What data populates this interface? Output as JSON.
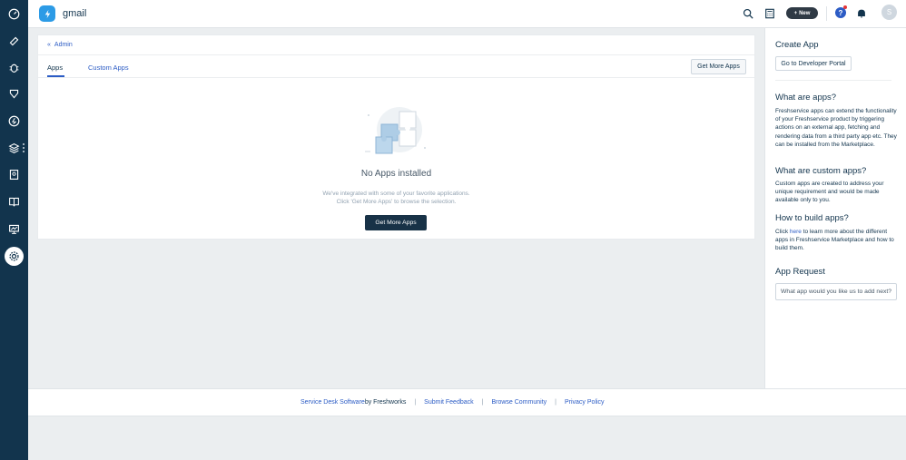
{
  "header": {
    "workspace_name": "gmail",
    "new_label": "New",
    "help_label": "?",
    "avatar_initial": "S"
  },
  "breadcrumb": {
    "label": "Admin"
  },
  "tabs": [
    {
      "label": "Apps",
      "active": true
    },
    {
      "label": "Custom Apps",
      "active": false
    }
  ],
  "toolbar": {
    "get_more_apps_label": "Get More Apps"
  },
  "empty_state": {
    "title": "No Apps installed",
    "description_line1": "We've integrated with some of your favorite applications.",
    "description_line2": "Click 'Get More Apps' to browse the selection.",
    "button_label": "Get More Apps"
  },
  "sidebar": {
    "create_app_title": "Create App",
    "developer_portal_label": "Go to Developer Portal",
    "what_are_apps_title": "What are apps?",
    "what_are_apps_text": "Freshservice apps can extend the functionality of your Freshservice product by triggering actions on an external app, fetching and rendering data from a third party app etc. They can be installed from the Marketplace.",
    "custom_apps_title": "What are custom apps?",
    "custom_apps_text": "Custom apps are created to address your unique requirement and would be made available only to you.",
    "build_apps_title": "How to build apps?",
    "build_apps_prefix": "Click ",
    "build_apps_link": "here",
    "build_apps_suffix": " to learn more about the different apps in Freshservice Marketplace and how to build them.",
    "app_request_title": "App Request",
    "app_request_placeholder": "What app would you like us to add next?"
  },
  "footer": {
    "service_desk_link": "Service Desk Software",
    "by_text": " by Freshworks",
    "separator": "|",
    "submit_feedback": "Submit Feedback",
    "browse_community": "Browse Community",
    "privacy_policy": "Privacy Policy"
  },
  "icons": {
    "nav": [
      "dashboard-icon",
      "tickets-icon",
      "problems-icon",
      "changes-icon",
      "releases-icon",
      "assets-icon",
      "contracts-icon",
      "solutions-icon",
      "reports-icon",
      "admin-gear-icon"
    ],
    "header": [
      "search-icon",
      "calculator-icon",
      "help-icon",
      "notification-bell-icon"
    ]
  },
  "colors": {
    "nav_bg": "#12344d",
    "accent": "#2c5cc5",
    "logo": "#2c9be6",
    "dark_button": "#183247"
  }
}
